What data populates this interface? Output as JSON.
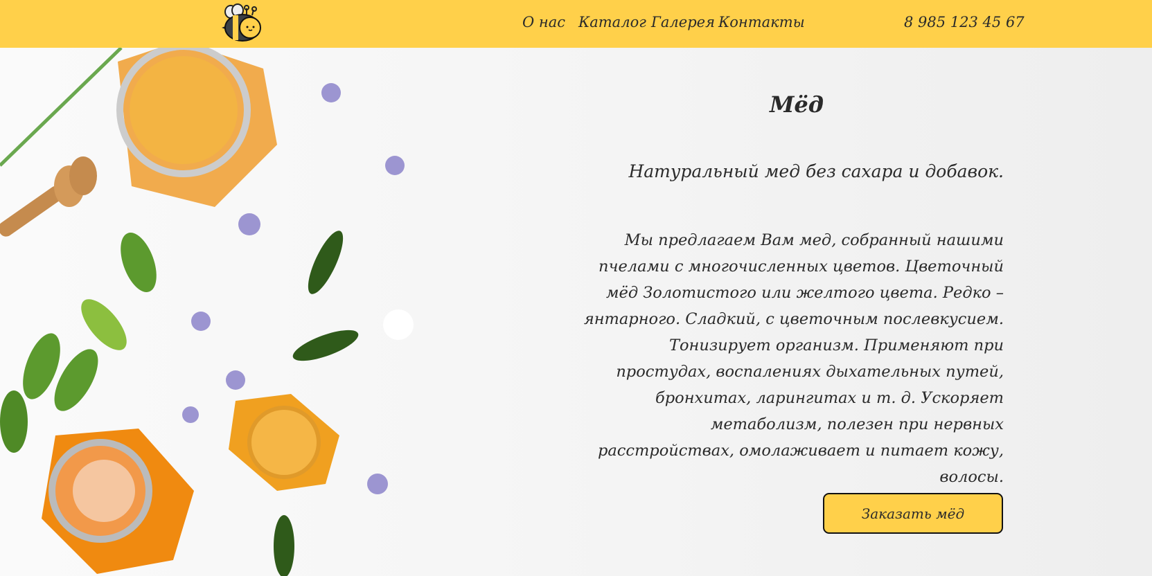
{
  "header": {
    "logo": "bee-logo",
    "nav": [
      "О нас",
      "Каталог",
      "Галерея",
      "Контакты"
    ],
    "phone": "8 985 123 45 67"
  },
  "main": {
    "title": "Мёд",
    "subtitle": "Натуральный мед без сахара и добавок.",
    "description": "Мы предлагаем Вам мед, собранный нашими пчелами с многочисленных цветов. Цветочный мёд Золотистого или желтого цвета. Редко – янтарного. Сладкий, с цветочным послевкусием. Тонизирует организм. Применяют при простудах, воспалениях дыхательных путей, бронхитах, ларингитах и т. д. Ускоряет метаболизм, полезен при нервных расстройствах, омолаживает и питает кожу, волосы.",
    "order_button": "Заказать мёд"
  },
  "colors": {
    "accent": "#ffd04a",
    "honey": "#f0a020"
  }
}
